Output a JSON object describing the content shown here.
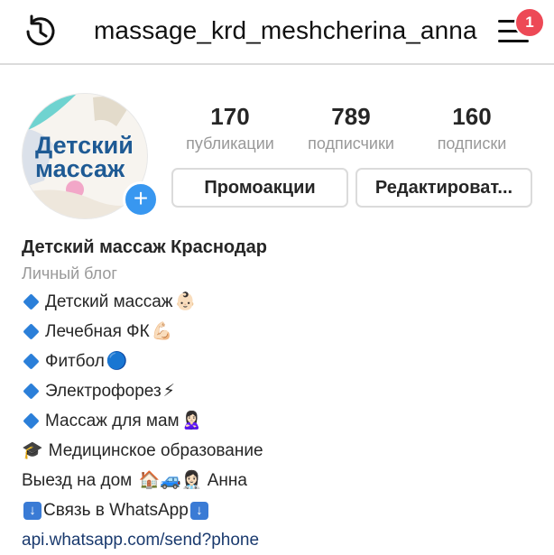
{
  "header": {
    "username": "massage_krd_meshcherina_anna",
    "notification_count": "1"
  },
  "profile": {
    "avatar_text_line1": "Детский",
    "avatar_text_line2": "массаж",
    "stats": [
      {
        "value": "170",
        "label": "публикации"
      },
      {
        "value": "789",
        "label": "подписчики"
      },
      {
        "value": "160",
        "label": "подписки"
      }
    ],
    "buttons": {
      "promo": "Промоакции",
      "edit": "Редактироват..."
    }
  },
  "bio": {
    "name": "Детский массаж Краснодар",
    "category": "Личный блог",
    "lines": [
      {
        "text": "Детский массаж",
        "emoji": "👶🏻"
      },
      {
        "text": "Лечебная ФК",
        "emoji": "💪🏻"
      },
      {
        "text": "Фитбол ",
        "emoji": "🔵"
      },
      {
        "text": "Электрофорез",
        "emoji": "⚡"
      },
      {
        "text": "Массаж для мам",
        "emoji": "🙎🏻‍♀️"
      }
    ],
    "education_icon": "🎓",
    "education": "Медицинское образование",
    "visit_text": "Выезд на дом",
    "visit_emojis": "🏠🚙👩🏻‍⚕️",
    "visit_name": "Анна",
    "whatsapp": "Связь в WhatsApp",
    "link": "api.whatsapp.com/send?phone"
  },
  "colors": {
    "accent": "#3897f0",
    "badge": "#ed4956",
    "link": "#1a3a6e"
  }
}
